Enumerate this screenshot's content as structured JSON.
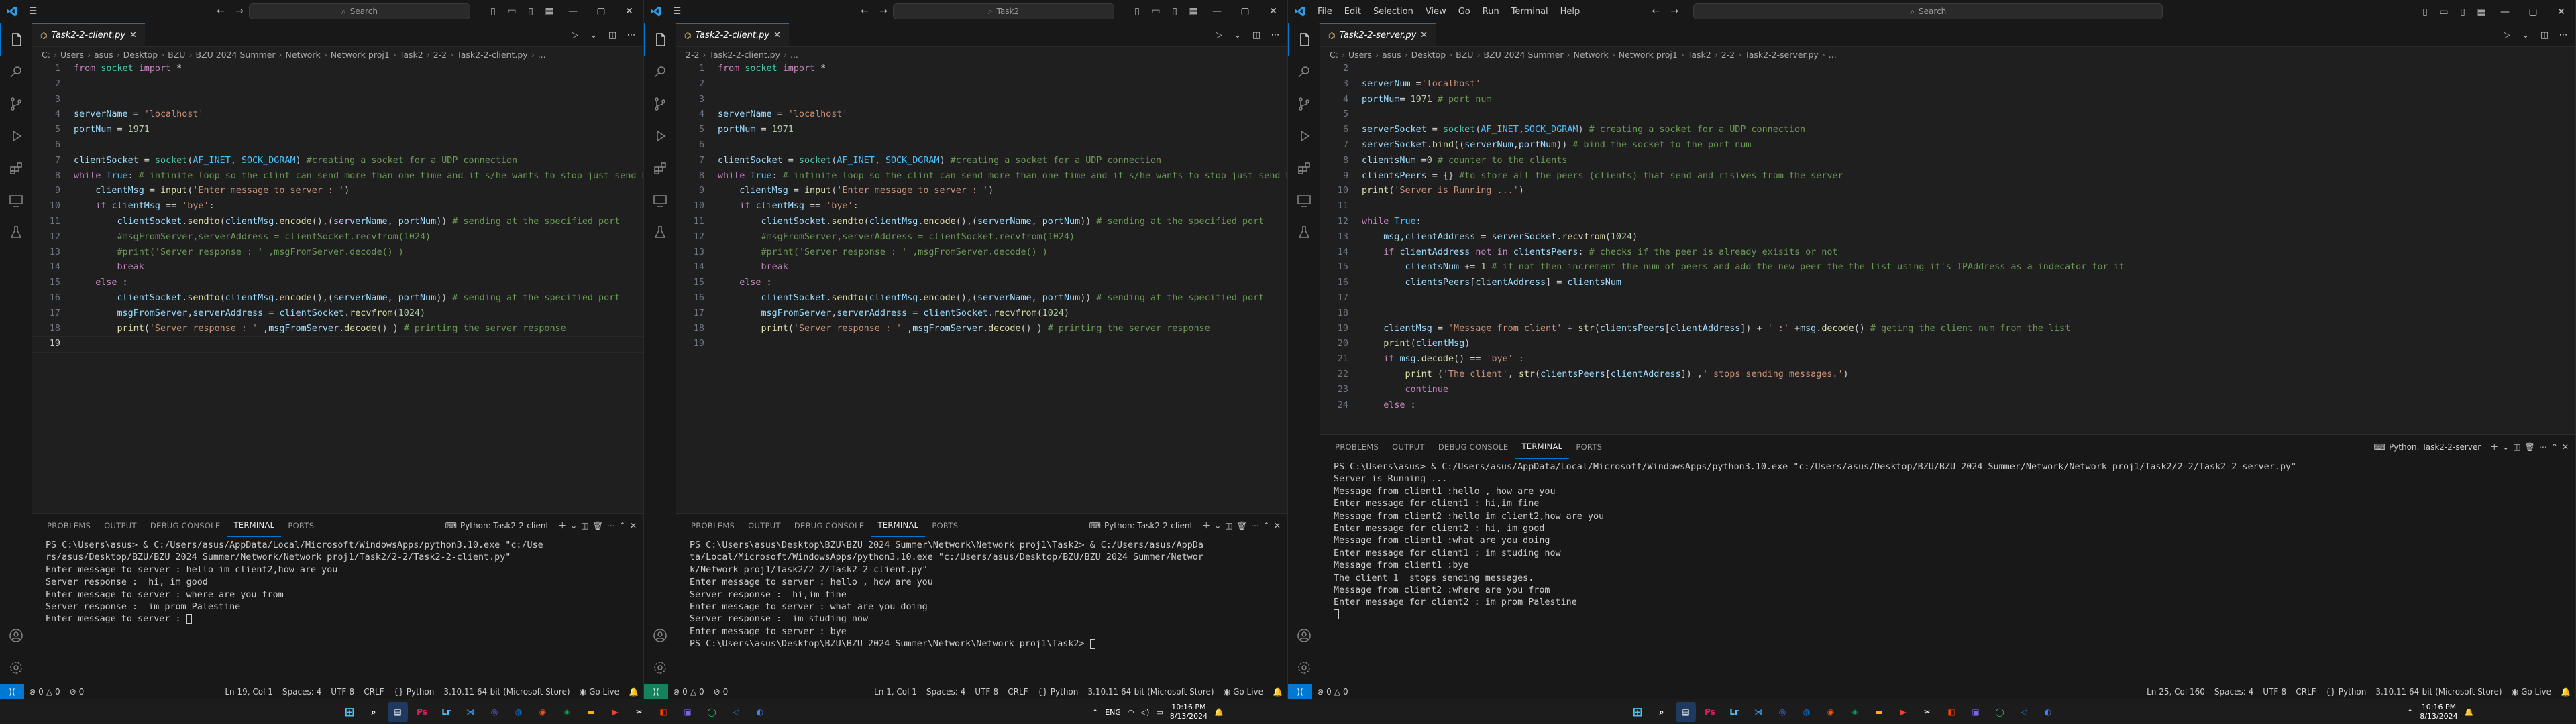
{
  "windows": [
    {
      "id": "w1",
      "search_placeholder": "Search",
      "tab_label": "Task2-2-client.py",
      "breadcrumb": [
        "C:",
        "Users",
        "asus",
        "Desktop",
        "BZU",
        "BZU 2024 Summer",
        "Network",
        "Network proj1",
        "Task2",
        "2-2",
        "Task2-2-client.py",
        "..."
      ],
      "panel_tabs": [
        "PROBLEMS",
        "OUTPUT",
        "DEBUG CONSOLE",
        "TERMINAL",
        "PORTS"
      ],
      "terminal_name": "Python: Task2-2-client",
      "terminal_lines": [
        "PS C:\\Users\\asus> & C:/Users/asus/AppData/Local/Microsoft/WindowsApps/python3.10.exe \"c:/Use",
        "rs/asus/Desktop/BZU/BZU 2024 Summer/Network/Network proj1/Task2/2-2/Task2-2-client.py\"",
        "Enter message to server : hello im client2,how are you",
        "Server response :  hi, im good",
        "Enter message to server : where are you from",
        "Server response :  im prom Palestine",
        "Enter message to server : "
      ],
      "status": {
        "errors": "0",
        "warnings": "0",
        "info": "0",
        "position": "Ln 19, Col 1",
        "spaces": "Spaces: 4",
        "encoding": "UTF-8",
        "eol": "CRLF",
        "language": "Python",
        "interpreter": "3.10.11 64-bit (Microsoft Store)",
        "golive": "Go Live"
      }
    },
    {
      "id": "w2",
      "search_placeholder": "Task2",
      "tab_label": "Task2-2-client.py",
      "breadcrumb": [
        "2-2",
        "Task2-2-client.py",
        "..."
      ],
      "panel_tabs": [
        "PROBLEMS",
        "OUTPUT",
        "DEBUG CONSOLE",
        "TERMINAL",
        "PORTS"
      ],
      "terminal_name": "Python: Task2-2-client",
      "terminal_lines": [
        "PS C:\\Users\\asus\\Desktop\\BZU\\BZU 2024 Summer\\Network\\Network proj1\\Task2> & C:/Users/asus/AppDa",
        "ta/Local/Microsoft/WindowsApps/python3.10.exe \"c:/Users/asus/Desktop/BZU/BZU 2024 Summer/Networ",
        "k/Network proj1/Task2/2-2/Task2-2-client.py\"",
        "Enter message to server : hello , how are you",
        "Server response :  hi,im fine",
        "Enter message to server : what are you doing",
        "Server response :  im studing now",
        "Enter message to server : bye",
        "PS C:\\Users\\asus\\Desktop\\BZU\\BZU 2024 Summer\\Network\\Network proj1\\Task2> "
      ],
      "status": {
        "errors": "0",
        "warnings": "0",
        "info": "0",
        "position": "Ln 1, Col 1",
        "spaces": "Spaces: 4",
        "encoding": "UTF-8",
        "eol": "CRLF",
        "language": "Python",
        "interpreter": "3.10.11 64-bit (Microsoft Store)",
        "golive": "Go Live"
      }
    },
    {
      "id": "w3",
      "menus": [
        "File",
        "Edit",
        "Selection",
        "View",
        "Go",
        "Run",
        "Terminal",
        "Help"
      ],
      "search_placeholder": "Search",
      "tab_label": "Task2-2-server.py",
      "breadcrumb": [
        "C:",
        "Users",
        "asus",
        "Desktop",
        "BZU",
        "BZU 2024 Summer",
        "Network",
        "Network proj1",
        "Task2",
        "2-2",
        "Task2-2-server.py",
        "..."
      ],
      "panel_tabs": [
        "PROBLEMS",
        "OUTPUT",
        "DEBUG CONSOLE",
        "TERMINAL",
        "PORTS"
      ],
      "terminal_name": "Python: Task2-2-server",
      "terminal_lines": [
        "PS C:\\Users\\asus> & C:/Users/asus/AppData/Local/Microsoft/WindowsApps/python3.10.exe \"c:/Users/asus/Desktop/BZU/BZU 2024 Summer/Network/Network proj1/Task2/2-2/Task2-2-server.py\"",
        "Server is Running ...",
        "Message from client1 :hello , how are you",
        "Enter message for client1 : hi,im fine",
        "Message from client2 :hello im client2,how are you",
        "Enter message for client2 : hi, im good",
        "Message from client1 :what are you doing",
        "Enter message for client1 : im studing now",
        "Message from client1 :bye",
        "The client 1  stops sending messages.",
        "Message from client2 :where are you from",
        "Enter message for client2 : im prom Palestine"
      ],
      "status": {
        "errors": "0",
        "warnings": "0",
        "info": "",
        "position": "Ln 25, Col 160",
        "spaces": "Spaces: 4",
        "encoding": "UTF-8",
        "eol": "CRLF",
        "language": "Python",
        "interpreter": "3.10.11 64-bit (Microsoft Store)",
        "golive": "Go Live"
      }
    }
  ],
  "code_client": [
    {
      "n": "1",
      "t": "from socket import *"
    },
    {
      "n": "2",
      "t": ""
    },
    {
      "n": "3",
      "t": ""
    },
    {
      "n": "4",
      "t": "serverName = 'localhost'"
    },
    {
      "n": "5",
      "t": "portNum = 1971"
    },
    {
      "n": "6",
      "t": ""
    },
    {
      "n": "7",
      "t": "clientSocket = socket(AF_INET, SOCK_DGRAM) #creating a socket for a UDP connection"
    },
    {
      "n": "8",
      "t": "while True: # infinite loop so the clint can send more than one time and if s/he wants to stop just send bye"
    },
    {
      "n": "9",
      "t": "    clientMsg = input('Enter message to server : ')"
    },
    {
      "n": "10",
      "t": "    if clientMsg == 'bye':"
    },
    {
      "n": "11",
      "t": "        clientSocket.sendto(clientMsg.encode(),(serverName, portNum)) # sending at the specified port"
    },
    {
      "n": "12",
      "t": "        #msgFromServer,serverAddress = clientSocket.recvfrom(1024)"
    },
    {
      "n": "13",
      "t": "        #print('Server response : ' ,msgFromServer.decode() )"
    },
    {
      "n": "14",
      "t": "        break"
    },
    {
      "n": "15",
      "t": "    else :"
    },
    {
      "n": "16",
      "t": "        clientSocket.sendto(clientMsg.encode(),(serverName, portNum)) # sending at the specified port"
    },
    {
      "n": "17",
      "t": "        msgFromServer,serverAddress = clientSocket.recvfrom(1024)"
    },
    {
      "n": "18",
      "t": "        print('Server response : ' ,msgFromServer.decode() ) # printing the server response"
    },
    {
      "n": "19",
      "t": ""
    }
  ],
  "code_server": [
    {
      "n": "2",
      "t": ""
    },
    {
      "n": "3",
      "t": "serverNum ='localhost'"
    },
    {
      "n": "4",
      "t": "portNum= 1971 # port num"
    },
    {
      "n": "5",
      "t": ""
    },
    {
      "n": "6",
      "t": "serverSocket = socket(AF_INET,SOCK_DGRAM) # creating a socket for a UDP connection"
    },
    {
      "n": "7",
      "t": "serverSocket.bind((serverNum,portNum)) # bind the socket to the port num"
    },
    {
      "n": "8",
      "t": "clientsNum =0 # counter to the clients"
    },
    {
      "n": "9",
      "t": "clientsPeers = {} #to store all the peers (clients) that send and risives from the server"
    },
    {
      "n": "10",
      "t": "print('Server is Running ...')"
    },
    {
      "n": "11",
      "t": ""
    },
    {
      "n": "12",
      "t": "while True:"
    },
    {
      "n": "13",
      "t": "    msg,clientAddress = serverSocket.recvfrom(1024)"
    },
    {
      "n": "14",
      "t": "    if clientAddress not in clientsPeers: # checks if the peer is already exisits or not"
    },
    {
      "n": "15",
      "t": "        clientsNum += 1 # if not then increment the num of peers and add the new peer the the list using it's IPAddress as a indecator for it"
    },
    {
      "n": "16",
      "t": "        clientsPeers[clientAddress] = clientsNum"
    },
    {
      "n": "17",
      "t": ""
    },
    {
      "n": "18",
      "t": ""
    },
    {
      "n": "19",
      "t": "    clientMsg = 'Message from client' + str(clientsPeers[clientAddress]) + ' :' +msg.decode() # geting the client num from the list"
    },
    {
      "n": "20",
      "t": "    print(clientMsg)"
    },
    {
      "n": "21",
      "t": "    if msg.decode() == 'bye' :"
    },
    {
      "n": "22",
      "t": "        print ('The client', str(clientsPeers[clientAddress]) ,' stops sending messages.')"
    },
    {
      "n": "23",
      "t": "        continue"
    },
    {
      "n": "24",
      "t": "    else :"
    }
  ],
  "taskbar": {
    "lang": "ENG",
    "time": "10:16 PM",
    "date": "8/13/2024"
  },
  "colors": {
    "accent": "#0078d4",
    "keyword": "#c586c0",
    "string": "#ce9178",
    "comment": "#6a9955",
    "function": "#dcdcaa"
  }
}
